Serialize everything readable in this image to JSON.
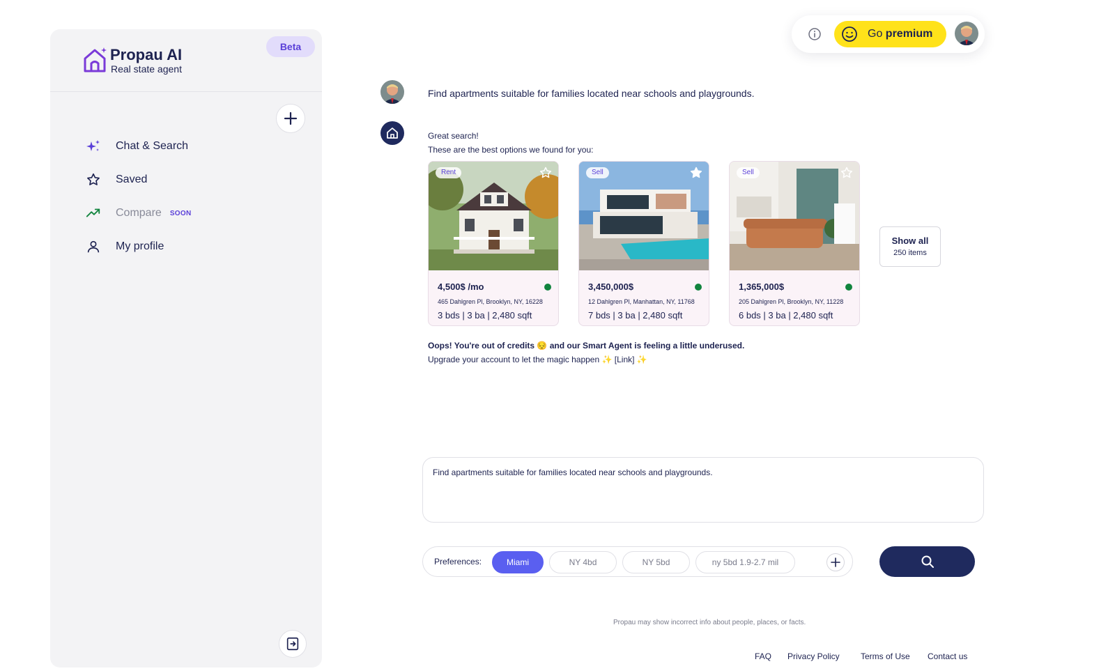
{
  "brand": {
    "name": "Propau AI",
    "subtitle": "Real state agent",
    "badge": "Beta"
  },
  "sidebar": {
    "items": [
      {
        "label": "Chat & Search",
        "icon": "sparkle-icon"
      },
      {
        "label": "Saved",
        "icon": "star-icon"
      },
      {
        "label": "Compare",
        "icon": "trend-up-icon",
        "badge": "SOON"
      },
      {
        "label": "My profile",
        "icon": "user-icon"
      }
    ]
  },
  "topbar": {
    "premium_prefix": "Go",
    "premium_bold": "premium"
  },
  "chat": {
    "user_message": "Find apartments suitable for families located near schools and playgrounds.",
    "bot_line1": "Great search!",
    "bot_line2": "These are the best options we found for you:",
    "listings": [
      {
        "tag": "Rent",
        "price": "4,500$ /mo",
        "address": "465 Dahlgren Pl, Brooklyn, NY, 16228",
        "specs": "3 bds | 3 ba | 2,480 sqft",
        "saved": false
      },
      {
        "tag": "Sell",
        "price": "3,450,000$",
        "address": "12 Dahlgren Pl, Manhattan, NY, 11768",
        "specs": "7 bds | 3 ba | 2,480 sqft",
        "saved": true
      },
      {
        "tag": "Sell",
        "price": "1,365,000$",
        "address": "205 Dahlgren Pl, Brooklyn, NY, 11228",
        "specs": "6 bds | 3 ba | 2,480 sqft",
        "saved": false
      }
    ],
    "show_all": {
      "label": "Show all",
      "count": "250 items"
    },
    "credits_line1": "Oops! You're out of credits 😔 and our Smart Agent is feeling a little underused.",
    "credits_line2": "Upgrade your account to let the magic happen ✨ [Link] ✨"
  },
  "input": {
    "value": "Find apartments suitable for families located near schools and playgrounds."
  },
  "preferences": {
    "label": "Preferences:",
    "chips": [
      {
        "label": "Miami",
        "active": true
      },
      {
        "label": "NY 4bd",
        "active": false
      },
      {
        "label": "NY 5bd",
        "active": false
      },
      {
        "label": "ny 5bd 1.9-2.7 mil",
        "active": false
      }
    ]
  },
  "disclaimer": "Propau may show incorrect info about people, places, or facts.",
  "footer": {
    "links": [
      "FAQ",
      "Privacy Policy",
      "Terms of Use",
      "Contact us"
    ]
  },
  "colors": {
    "accent": "#5a3fd8",
    "navy": "#1f2a5e",
    "premium": "#ffe21a",
    "available": "#11843e",
    "chip_active": "#5a5ff0"
  }
}
